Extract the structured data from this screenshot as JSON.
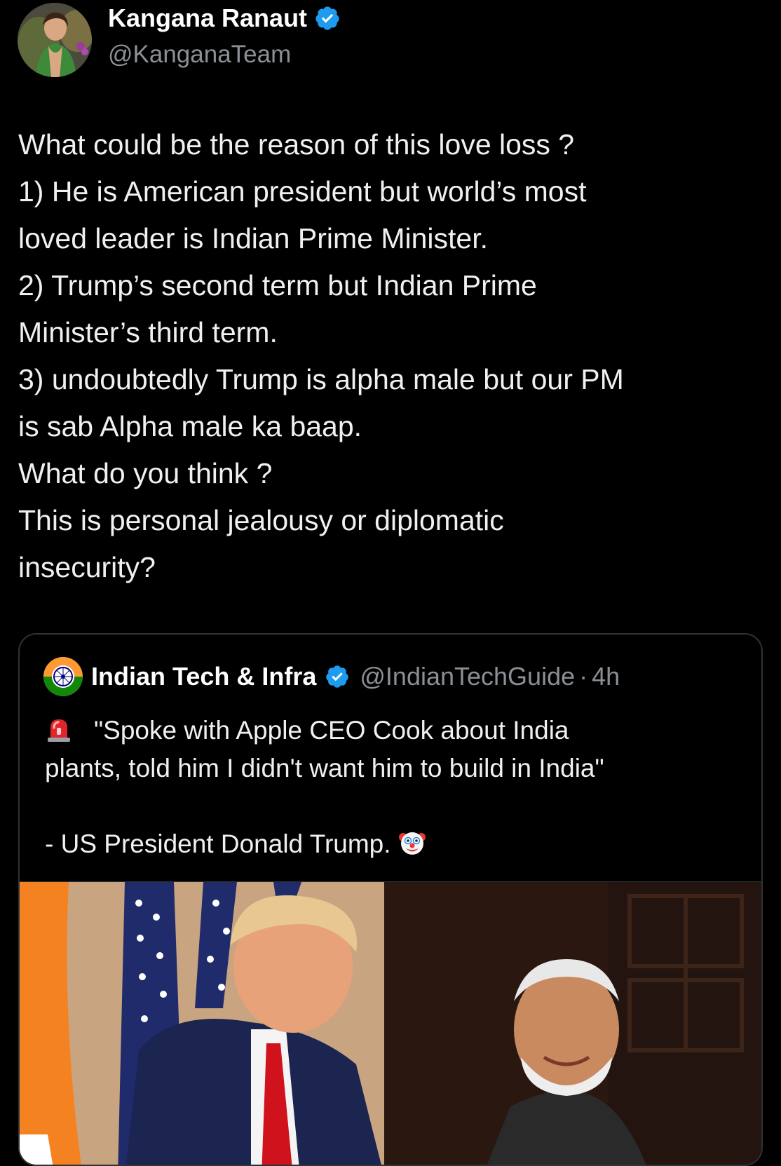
{
  "author": {
    "name": "Kangana Ranaut",
    "handle": "@KanganaTeam",
    "verified_color": "#1d9bf0"
  },
  "tweet": {
    "lines": [
      "What could be the reason of this love loss ?",
      "1) He is American president but world’s most",
      "loved leader is Indian Prime Minister.",
      "2) Trump’s second term but Indian Prime",
      "Minister’s third term.",
      "3) undoubtedly Trump is alpha male but our PM",
      "is sab Alpha male ka baap.",
      "What do you think ?",
      "This is personal jealousy or diplomatic",
      "insecurity?"
    ]
  },
  "quote": {
    "name": "Indian Tech & Infra",
    "handle": "@IndianTechGuide",
    "separator": "·",
    "time": "4h",
    "line1": "\"Spoke with Apple CEO Cook about India",
    "line2": "plants, told him I didn't want him to build in India\"",
    "line3": "- US President Donald Trump.",
    "icons": {
      "lead": "rotating-light-icon",
      "trail": "clown-face-icon"
    }
  },
  "colors": {
    "background": "#000000",
    "text": "#e7e9ea",
    "muted": "#8b9096",
    "border": "#2f3336"
  }
}
